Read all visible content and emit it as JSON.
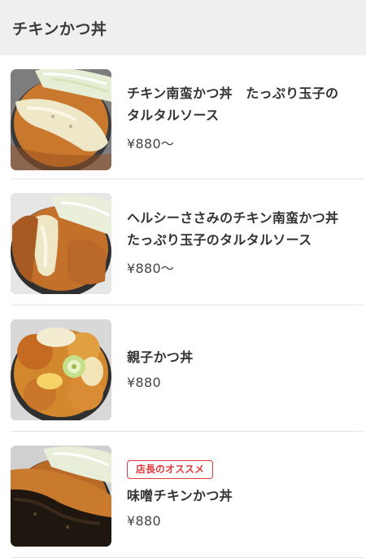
{
  "header": {
    "title": "チキンかつ丼"
  },
  "items": [
    {
      "name": "チキン南蛮かつ丼　たっぷり玉子のタルタルソース",
      "price": "¥880〜",
      "badge": "",
      "image": "chicken-nanban-katsudon-photo"
    },
    {
      "name": "ヘルシーささみのチキン南蛮かつ丼　たっぷり玉子のタルタルソース",
      "price": "¥880〜",
      "badge": "",
      "image": "sasami-chicken-nanban-katsudon-photo"
    },
    {
      "name": "親子かつ丼",
      "price": "¥880",
      "badge": "",
      "image": "oyako-katsudon-photo"
    },
    {
      "name": "味噌チキンかつ丼",
      "price": "¥880",
      "badge": "店長のオススメ",
      "image": "miso-chicken-katsudon-photo"
    }
  ],
  "colors": {
    "header_bg": "#efefef",
    "badge": "#e03a3a",
    "divider": "#e6e6e6"
  }
}
